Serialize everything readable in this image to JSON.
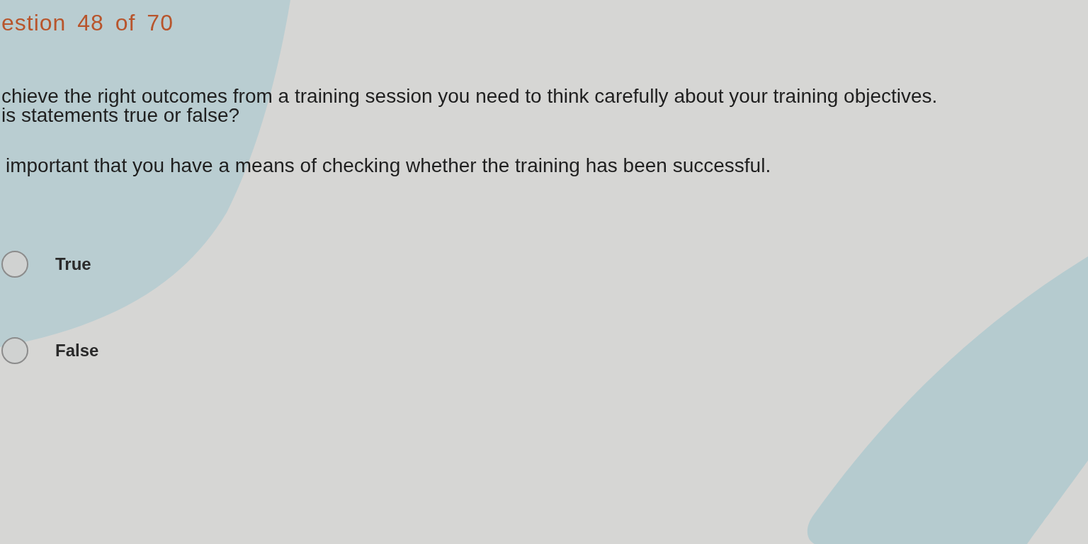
{
  "header": {
    "title": "estion 48 of 70"
  },
  "question": {
    "lines": [
      "chieve the right outcomes from a training session you need to think carefully about your training objectives.",
      "is statements true or false?"
    ],
    "statement": "important that you have a means of checking whether the training has been successful."
  },
  "options": [
    {
      "label": "True",
      "selected": false
    },
    {
      "label": "False",
      "selected": false
    }
  ]
}
